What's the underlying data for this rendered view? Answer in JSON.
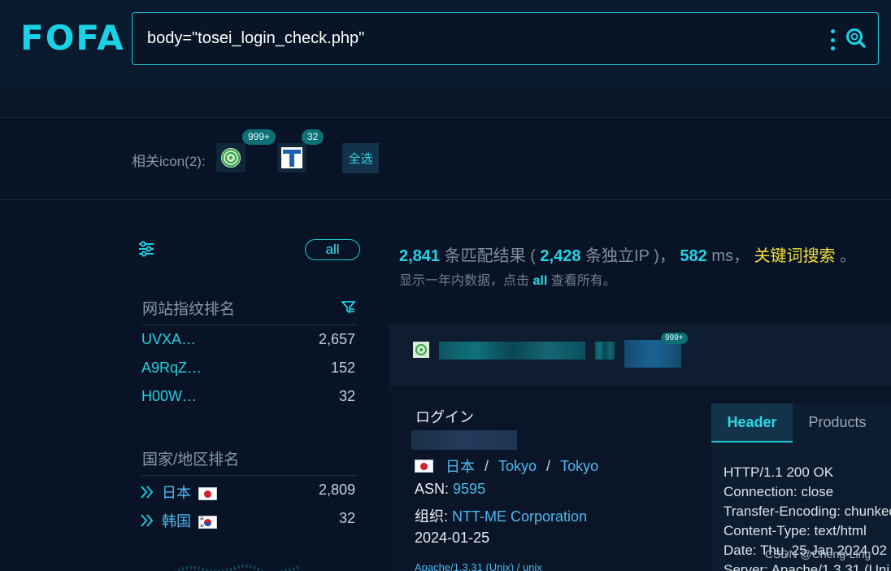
{
  "header": {
    "logo_text": "FOFA",
    "search_query": "body=\"tosei_login_check.php\"",
    "more_icon": "kebab-menu-icon",
    "search_icon": "search-icon"
  },
  "related_icons": {
    "label": "相关icon(2):",
    "items": [
      {
        "icon": "green-circle-icon",
        "badge": "999+"
      },
      {
        "icon": "t-letter-icon",
        "badge": "32"
      }
    ],
    "select_all": "全选"
  },
  "sidebar": {
    "all_label": "all",
    "fingerprint": {
      "title": "网站指纹排名",
      "items": [
        {
          "name": "UVXA…",
          "count": "2,657"
        },
        {
          "name": "A9RqZ…",
          "count": "152"
        },
        {
          "name": "H00W…",
          "count": "32"
        }
      ]
    },
    "country": {
      "title": "国家/地区排名",
      "items": [
        {
          "name": "日本",
          "flag": "jp",
          "count": "2,809"
        },
        {
          "name": "韩国",
          "flag": "kr",
          "count": "32"
        }
      ]
    }
  },
  "summary": {
    "results": "2,841",
    "results_label": "条匹配结果",
    "open_paren": "(",
    "unique_ip": "2,428",
    "unique_ip_label": "条独立IP",
    "close_paren": ")，",
    "ms": "582",
    "ms_label": "ms，",
    "keyword_search": "关键词搜索",
    "period": "。",
    "note_prefix": "显示一年内数据，点击",
    "note_link": "all",
    "note_suffix": "查看所有。"
  },
  "result": {
    "badge": "999+",
    "title": "ログイン",
    "country": "日本",
    "region": "Tokyo",
    "city": "Tokyo",
    "asn_label": "ASN:",
    "asn": "9595",
    "org_label": "组织:",
    "org": "NTT-ME Corporation",
    "date": "2024-01-25",
    "tag_text": "Apache/1.3.31 (Unix)   /   unix",
    "tabs": [
      "Header",
      "Products"
    ],
    "header_lines": [
      "HTTP/1.1 200 OK",
      "Connection: close",
      "Transfer-Encoding: chunked",
      "Content-Type: text/html",
      "Date: Thu, 25 Jan 2024 02",
      "Server: Apache/1.3.31 (Uni"
    ]
  },
  "watermark": "CSDN @Cheng-Ling",
  "colors": {
    "accent": "#1ec8d8",
    "keyword": "#f2de3a",
    "link": "#4fb8f0",
    "background": "#081426"
  }
}
